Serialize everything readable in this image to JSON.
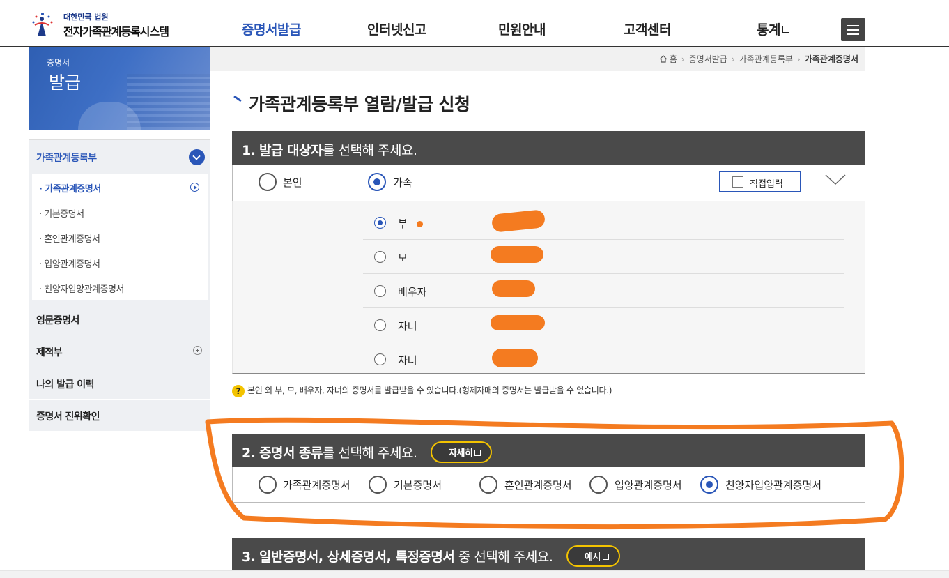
{
  "header": {
    "logo_small": "대한민국 법원",
    "logo_big": "전자가족관계등록시스템",
    "nav": [
      {
        "label": "증명서발급",
        "active": true
      },
      {
        "label": "인터넷신고"
      },
      {
        "label": "민원안내"
      },
      {
        "label": "고객센터"
      },
      {
        "label": "통계",
        "external": true
      }
    ]
  },
  "sidebar": {
    "banner_small": "증명서",
    "banner_big": "발급",
    "section_title": "가족관계등록부",
    "sub_items": [
      {
        "label": "가족관계증명서",
        "active": true
      },
      {
        "label": "기본증명서"
      },
      {
        "label": "혼인관계증명서"
      },
      {
        "label": "입양관계증명서"
      },
      {
        "label": "친양자입양관계증명서"
      }
    ],
    "main_items": [
      {
        "label": "영문증명서"
      },
      {
        "label": "제적부",
        "expandable": true
      },
      {
        "label": "나의 발급 이력"
      },
      {
        "label": "증명서 진위확인"
      }
    ]
  },
  "breadcrumb": [
    "홈",
    "증명서발급",
    "가족관계등록부",
    "가족관계증명서"
  ],
  "page_title": "가족관계등록부 열람/발급 신청",
  "section1": {
    "num": "1.",
    "bold": "발급 대상자",
    "rest": "를 선택해 주세요.",
    "options": [
      {
        "label": "본인",
        "selected": false
      },
      {
        "label": "가족",
        "selected": true
      }
    ],
    "direct_input": "직접입력",
    "family": [
      {
        "label": "부",
        "selected": true
      },
      {
        "label": "모",
        "selected": false
      },
      {
        "label": "배우자",
        "selected": false
      },
      {
        "label": "자녀",
        "selected": false
      },
      {
        "label": "자녀",
        "selected": false
      }
    ],
    "help": "본인 외 부, 모, 배우자, 자녀의 증명서를 발급받을 수 있습니다.(형제자매의 증명서는 발급받을 수 없습니다.)"
  },
  "section2": {
    "num": "2.",
    "bold": "증명서 종류",
    "rest": "를 선택해 주세요.",
    "detail_button": "자세히",
    "options": [
      {
        "label": "가족관계증명서",
        "selected": false
      },
      {
        "label": "기본증명서",
        "selected": false
      },
      {
        "label": "혼인관계증명서",
        "selected": false
      },
      {
        "label": "입양관계증명서",
        "selected": false
      },
      {
        "label": "친양자입양관계증명서",
        "selected": true
      }
    ]
  },
  "section3": {
    "num": "3.",
    "bold": "일반증명서, 상세증명서, 특정증명서",
    "rest": " 중 선택해 주세요.",
    "example_button": "예시"
  },
  "colors": {
    "brand_blue": "#2a56b8",
    "section_header": "#4a4a4a",
    "annotation_orange": "#f47b20",
    "pill_border": "#f3c300"
  }
}
